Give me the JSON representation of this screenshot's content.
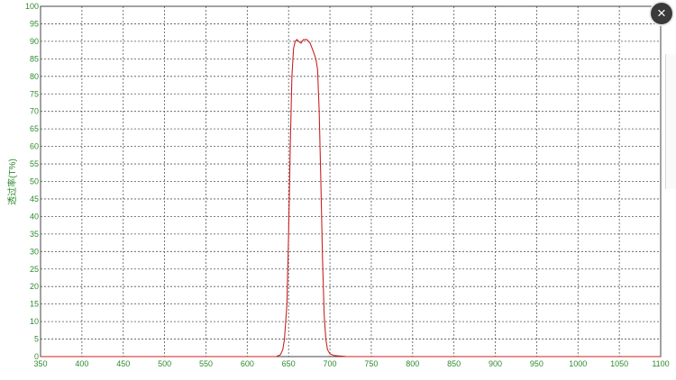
{
  "close": {
    "label": "×",
    "icon": "close-icon"
  },
  "chart_data": {
    "type": "line",
    "xlabel": "",
    "ylabel": "透过率(T%)",
    "xlim": [
      350,
      1100
    ],
    "ylim": [
      0,
      100
    ],
    "x_ticks": [
      350,
      400,
      450,
      500,
      550,
      600,
      650,
      700,
      750,
      800,
      850,
      900,
      950,
      1000,
      1050,
      1100
    ],
    "y_ticks": [
      0,
      5,
      10,
      15,
      20,
      25,
      30,
      35,
      40,
      45,
      50,
      55,
      60,
      65,
      70,
      75,
      80,
      85,
      90,
      95,
      100
    ],
    "grid": true,
    "grid_style": "dashed",
    "line_color": "#cc2222",
    "tick_color": "#2e8b2e",
    "series": [
      {
        "x": [
          350,
          600,
          635,
          640,
          643,
          645,
          648,
          650,
          652,
          654,
          656,
          658,
          660,
          662,
          665,
          668,
          672,
          676,
          680,
          683,
          685,
          687,
          689,
          691,
          693,
          695,
          697,
          700,
          705,
          720,
          800,
          1100
        ],
        "y": [
          0,
          0,
          0,
          0.5,
          2,
          5,
          15,
          35,
          60,
          80,
          88,
          90,
          90.5,
          90,
          89.5,
          90.5,
          90.5,
          89.5,
          87,
          85,
          82,
          70,
          50,
          28,
          12,
          5,
          2,
          0.8,
          0.3,
          0,
          0,
          0
        ]
      }
    ]
  }
}
